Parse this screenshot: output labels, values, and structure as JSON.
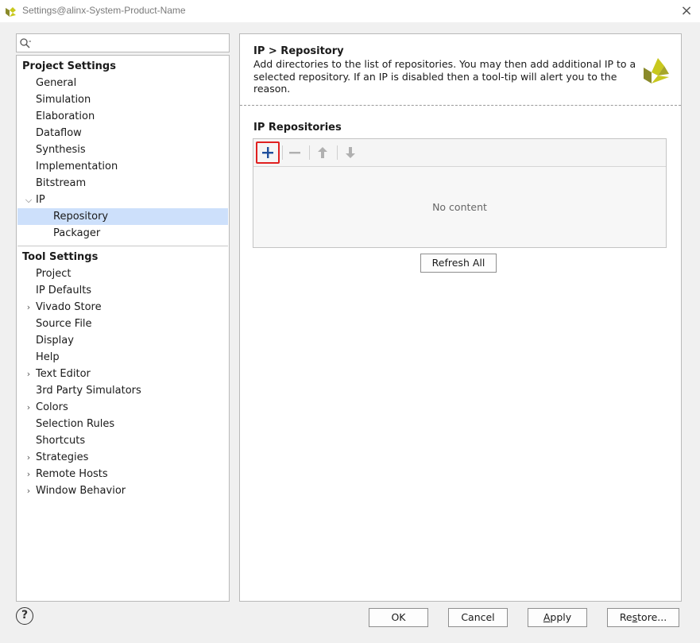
{
  "window": {
    "title": "Settings@alinx-System-Product-Name",
    "close_glyph": "×"
  },
  "search": {
    "placeholder": "",
    "value": ""
  },
  "tree": {
    "project_header": "Project Settings",
    "project_items": [
      "General",
      "Simulation",
      "Elaboration",
      "Dataflow",
      "Synthesis",
      "Implementation",
      "Bitstream"
    ],
    "ip_label": "IP",
    "ip_children": [
      "Repository",
      "Packager"
    ],
    "tool_header": "Tool Settings",
    "tool_items": [
      "Project",
      "IP Defaults",
      "Vivado Store",
      "Source File",
      "Display",
      "Help",
      "Text Editor",
      "3rd Party Simulators",
      "Colors",
      "Selection Rules",
      "Shortcuts",
      "Strategies",
      "Remote Hosts",
      "Window Behavior"
    ]
  },
  "content": {
    "breadcrumb": "IP > Repository",
    "description": "Add directories to the list of repositories. You may then add additional IP to a selected repository. If an IP is disabled then a tool-tip will alert you to the reason.",
    "section_title": "IP Repositories",
    "empty_text": "No content",
    "refresh_label": "Refresh All"
  },
  "footer": {
    "help_glyph": "?",
    "ok_label": "OK",
    "cancel_label": "Cancel",
    "apply_label_first": "A",
    "apply_label_rest": "pply",
    "restore_label_first": "Re",
    "restore_label_u": "s",
    "restore_label_rest": "tore..."
  },
  "colors": {
    "selection": "#cde0fb",
    "add_highlight": "#e02020",
    "add_icon": "#1f4e9c",
    "logo_yellow": "#c8c81e",
    "logo_olive": "#8a8a2a"
  }
}
